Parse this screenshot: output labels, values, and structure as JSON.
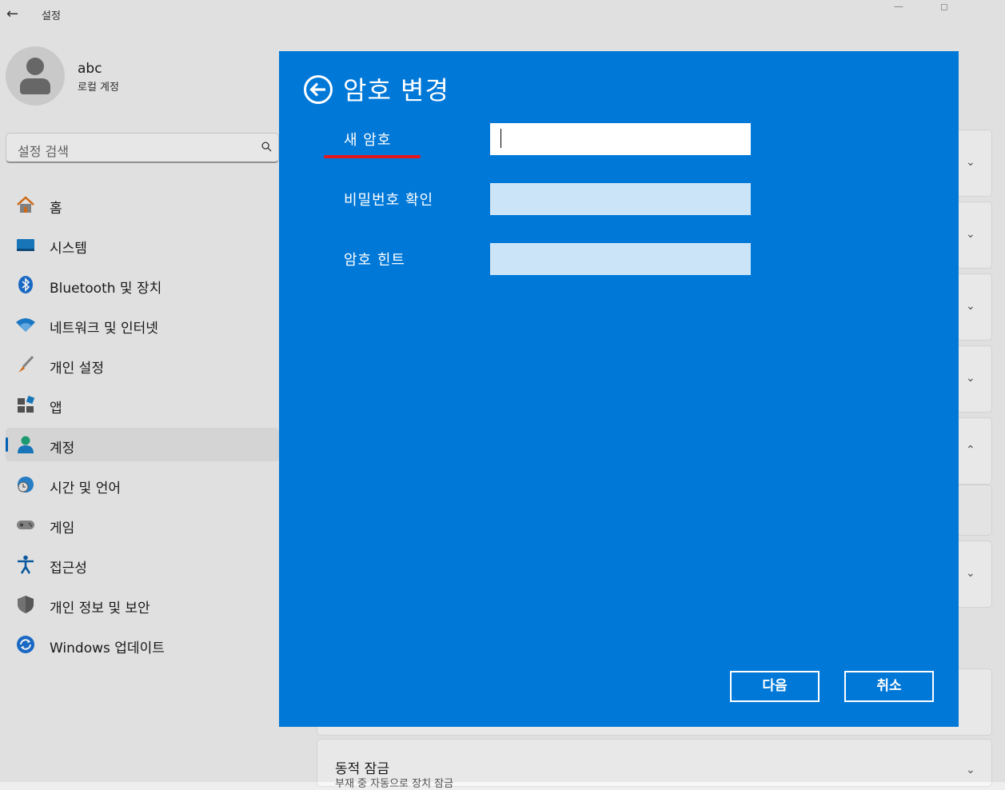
{
  "window": {
    "title": "설정",
    "controls": [
      "minimize-icon",
      "maximize-icon"
    ]
  },
  "user": {
    "name": "abc",
    "account_type": "로컬 계정"
  },
  "search": {
    "placeholder": "설정 검색",
    "icon": "search-icon"
  },
  "nav": {
    "items": [
      {
        "label": "홈",
        "icon": "home-icon"
      },
      {
        "label": "시스템",
        "icon": "system-icon"
      },
      {
        "label": "Bluetooth 및 장치",
        "icon": "bluetooth-icon"
      },
      {
        "label": "네트워크 및 인터넷",
        "icon": "wifi-icon"
      },
      {
        "label": "개인 설정",
        "icon": "brush-icon"
      },
      {
        "label": "앱",
        "icon": "apps-icon"
      },
      {
        "label": "계정",
        "icon": "account-icon",
        "selected": true
      },
      {
        "label": "시간 및 언어",
        "icon": "time-language-icon"
      },
      {
        "label": "게임",
        "icon": "gamepad-icon"
      },
      {
        "label": "접근성",
        "icon": "accessibility-icon"
      },
      {
        "label": "개인 정보 및 보안",
        "icon": "shield-icon"
      },
      {
        "label": "Windows 업데이트",
        "icon": "update-icon"
      }
    ]
  },
  "background": {
    "dynamic_lock": {
      "title": "동적 잠금",
      "subtitle": "부재 중 자동으로 장치 잠금"
    }
  },
  "dialog": {
    "title": "암호 변경",
    "fields": [
      {
        "label": "새 암호",
        "value": "",
        "active": true
      },
      {
        "label": "비밀번호 확인",
        "value": "",
        "active": false
      },
      {
        "label": "암호 힌트",
        "value": "",
        "active": false
      }
    ],
    "next_label": "다음",
    "cancel_label": "취소",
    "highlight_color": "#e5161b",
    "background_color": "#0078d7"
  }
}
